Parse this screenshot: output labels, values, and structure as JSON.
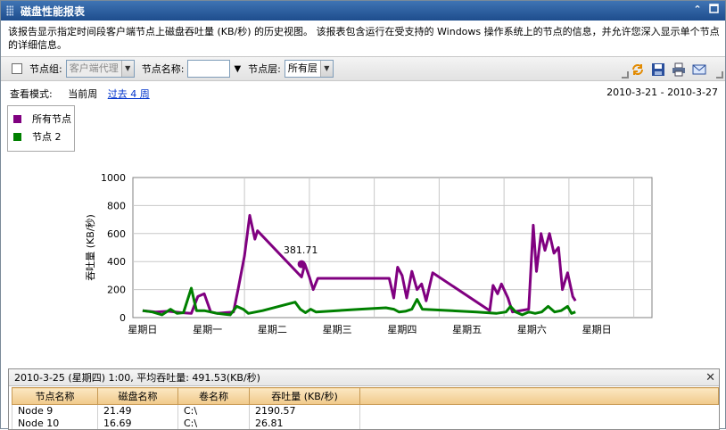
{
  "window": {
    "title": "磁盘性能报表"
  },
  "description": "该报告显示指定时间段客户端节点上磁盘吞吐量 (KB/秒) 的历史视图。 该报表包含运行在受支持的 Windows 操作系统上的节点的信息，并允许您深入显示单个节点的详细信息。",
  "toolbar": {
    "node_group_label": "节点组:",
    "node_group_value": "客户端代理",
    "node_name_label": "节点名称:",
    "node_name_value": "",
    "node_tier_label": "节点层:",
    "node_tier_value": "所有层"
  },
  "view": {
    "mode_label": "查看模式:",
    "current_week": "当前周",
    "past_weeks_link": "过去 4 周",
    "date_range": "2010-3-21 - 2010-3-27"
  },
  "legend": [
    {
      "label": "所有节点",
      "color": "#800080"
    },
    {
      "label": "节点 2",
      "color": "#008000"
    }
  ],
  "chart_data": {
    "type": "line",
    "ylabel": "吞吐量 (KB/秒)",
    "ylim": [
      0,
      1000
    ],
    "yticks": [
      "0",
      "200",
      "400",
      "600",
      "800",
      "1000"
    ],
    "xticks": [
      "星期日",
      "星期一",
      "星期二",
      "星期三",
      "星期四",
      "星期五",
      "星期六",
      "星期日"
    ],
    "xlim": [
      0,
      8
    ],
    "annotation": {
      "label": "381.71",
      "x": 2.6,
      "y": 381.71
    },
    "series": [
      {
        "name": "所有节点",
        "color": "#800080",
        "points": [
          [
            0.15,
            50
          ],
          [
            0.35,
            40
          ],
          [
            0.55,
            45
          ],
          [
            0.75,
            35
          ],
          [
            0.9,
            30
          ],
          [
            1.0,
            150
          ],
          [
            1.1,
            170
          ],
          [
            1.2,
            40
          ],
          [
            1.3,
            30
          ],
          [
            1.55,
            40
          ],
          [
            1.62,
            200
          ],
          [
            1.72,
            440
          ],
          [
            1.8,
            730
          ],
          [
            1.88,
            560
          ],
          [
            1.92,
            620
          ],
          [
            2.6,
            290
          ],
          [
            2.65,
            381.71
          ],
          [
            2.72,
            290
          ],
          [
            2.78,
            200
          ],
          [
            2.85,
            280
          ],
          [
            3.95,
            280
          ],
          [
            4.02,
            140
          ],
          [
            4.08,
            360
          ],
          [
            4.15,
            300
          ],
          [
            4.22,
            140
          ],
          [
            4.3,
            330
          ],
          [
            4.38,
            200
          ],
          [
            4.45,
            240
          ],
          [
            4.52,
            120
          ],
          [
            4.62,
            320
          ],
          [
            5.5,
            50
          ],
          [
            5.55,
            230
          ],
          [
            5.62,
            170
          ],
          [
            5.68,
            240
          ],
          [
            5.78,
            140
          ],
          [
            5.85,
            40
          ],
          [
            6.1,
            60
          ],
          [
            6.17,
            660
          ],
          [
            6.22,
            330
          ],
          [
            6.29,
            600
          ],
          [
            6.35,
            480
          ],
          [
            6.42,
            600
          ],
          [
            6.49,
            460
          ],
          [
            6.56,
            500
          ],
          [
            6.62,
            200
          ],
          [
            6.7,
            320
          ],
          [
            6.78,
            150
          ],
          [
            6.82,
            120
          ]
        ]
      },
      {
        "name": "节点 2",
        "color": "#008000",
        "points": [
          [
            0.15,
            50
          ],
          [
            0.3,
            40
          ],
          [
            0.45,
            20
          ],
          [
            0.58,
            60
          ],
          [
            0.68,
            30
          ],
          [
            0.78,
            35
          ],
          [
            0.9,
            210
          ],
          [
            0.98,
            50
          ],
          [
            1.1,
            50
          ],
          [
            1.2,
            40
          ],
          [
            1.3,
            30
          ],
          [
            1.5,
            20
          ],
          [
            1.6,
            80
          ],
          [
            1.7,
            60
          ],
          [
            1.78,
            30
          ],
          [
            2.0,
            50
          ],
          [
            2.5,
            110
          ],
          [
            2.58,
            60
          ],
          [
            2.66,
            35
          ],
          [
            2.74,
            60
          ],
          [
            2.82,
            40
          ],
          [
            3.5,
            60
          ],
          [
            3.9,
            70
          ],
          [
            4.02,
            60
          ],
          [
            4.1,
            40
          ],
          [
            4.2,
            45
          ],
          [
            4.3,
            60
          ],
          [
            4.38,
            130
          ],
          [
            4.46,
            60
          ],
          [
            5.3,
            40
          ],
          [
            5.6,
            30
          ],
          [
            5.75,
            40
          ],
          [
            5.82,
            80
          ],
          [
            5.9,
            40
          ],
          [
            6.0,
            20
          ],
          [
            6.1,
            40
          ],
          [
            6.2,
            30
          ],
          [
            6.3,
            40
          ],
          [
            6.4,
            80
          ],
          [
            6.5,
            40
          ],
          [
            6.6,
            50
          ],
          [
            6.7,
            80
          ],
          [
            6.76,
            30
          ],
          [
            6.82,
            40
          ]
        ]
      }
    ]
  },
  "detail": {
    "header": "2010-3-25 (星期四) 1:00, 平均吞吐量: 491.53(KB/秒)",
    "columns": [
      "节点名称",
      "磁盘名称",
      "卷名称",
      "吞吐量 (KB/秒)"
    ],
    "rows": [
      [
        "Node 9",
        "21.49",
        "C:\\",
        "2190.57"
      ],
      [
        "Node 10",
        "16.69",
        "C:\\",
        "26.81"
      ]
    ]
  },
  "icons": [
    "grip-icon",
    "collapse-icon",
    "restore-icon",
    "refresh-icon",
    "save-icon",
    "print-icon",
    "email-icon",
    "close-icon"
  ]
}
